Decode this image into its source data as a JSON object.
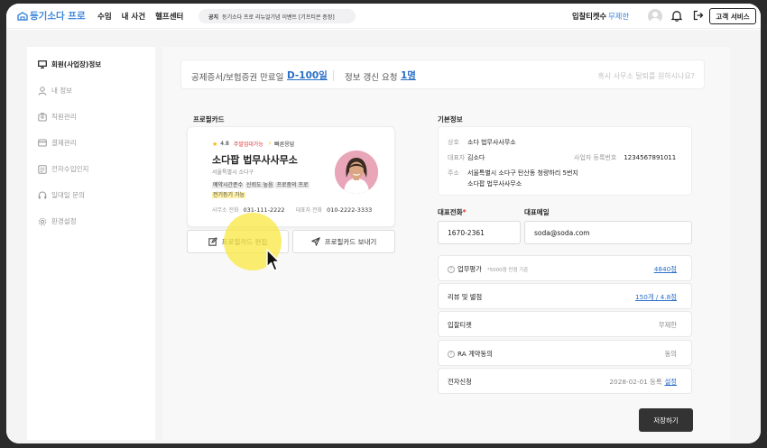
{
  "header": {
    "logo": "등기소다 프로",
    "nav": [
      "수임",
      "내 사건",
      "헬프센터"
    ],
    "notice_label": "공지",
    "notice_text": "등기소다 프로 리뉴얼기념 이벤트 [기프티콘 증정]",
    "ticket_label": "입찰티켓수",
    "ticket_value": "무제한",
    "support_button": "고객 서비스"
  },
  "sidebar": {
    "items": [
      {
        "label": "회원(사업장)정보",
        "icon": "monitor-icon"
      },
      {
        "label": "내 정보",
        "icon": "person-icon"
      },
      {
        "label": "직원관리",
        "icon": "badge-icon"
      },
      {
        "label": "결제관리",
        "icon": "card-icon"
      },
      {
        "label": "전자수입인지",
        "icon": "stamp-icon"
      },
      {
        "label": "일대일 문의",
        "icon": "headset-icon"
      },
      {
        "label": "환경설정",
        "icon": "gear-icon"
      }
    ]
  },
  "summary": {
    "cert_label": "공제증서/보험증권 만료일",
    "cert_value": "D-100일",
    "update_label": "정보 갱신 요청",
    "update_value": "1명",
    "hint": "혹시 사무소 탈퇴를 원하시나요?"
  },
  "profile": {
    "section_title": "프로필카드",
    "rating": "4.8",
    "tag_weekend": "주말업대가능",
    "tag_fast": "빠른응답",
    "office_name": "소다팝 법무사사무소",
    "region": "서울특별시 소다구",
    "keywords": [
      "예약시간준수",
      "신뢰도 높음",
      "프로중의 프로",
      "전기등기 가능"
    ],
    "office_phone_label": "사무소 전화",
    "office_phone": "031-111-2222",
    "rep_phone_label": "대표자 전화",
    "rep_phone": "010-2222-3333",
    "edit_button": "프로필카드 편집",
    "send_button": "프로필카드 보내기"
  },
  "basic": {
    "section_title": "기본정보",
    "name_label": "상호",
    "name_value": "소다 법무사사무소",
    "rep_label": "대표자",
    "rep_value": "김소다",
    "biz_label": "사업자 등록번호",
    "biz_value": "1234567891011",
    "addr_label": "주소",
    "addr_line1": "서울특별시 소다구 탄산동 청량하리 5번지",
    "addr_line2": "소다팝 법무사사무소",
    "phone_label": "대표전화",
    "phone_required": "*",
    "phone_value": "1670-2361",
    "email_label": "대표메일",
    "email_value": "soda@soda.com"
  },
  "rows": {
    "eval_label": "업무평가",
    "eval_sub": "*5000점 만점 기준",
    "eval_value": "4840점",
    "review_label": "리뷰 및 별점",
    "review_value": "150개 / 4.8점",
    "ticket_label": "입찰티켓",
    "ticket_value": "무제한",
    "ra_label": "RA 계약동의",
    "ra_value": "동의",
    "esign_label": "전자신청",
    "esign_value": "2028-02-01 등록",
    "esign_link": "설정"
  },
  "save_button": "저장하기"
}
